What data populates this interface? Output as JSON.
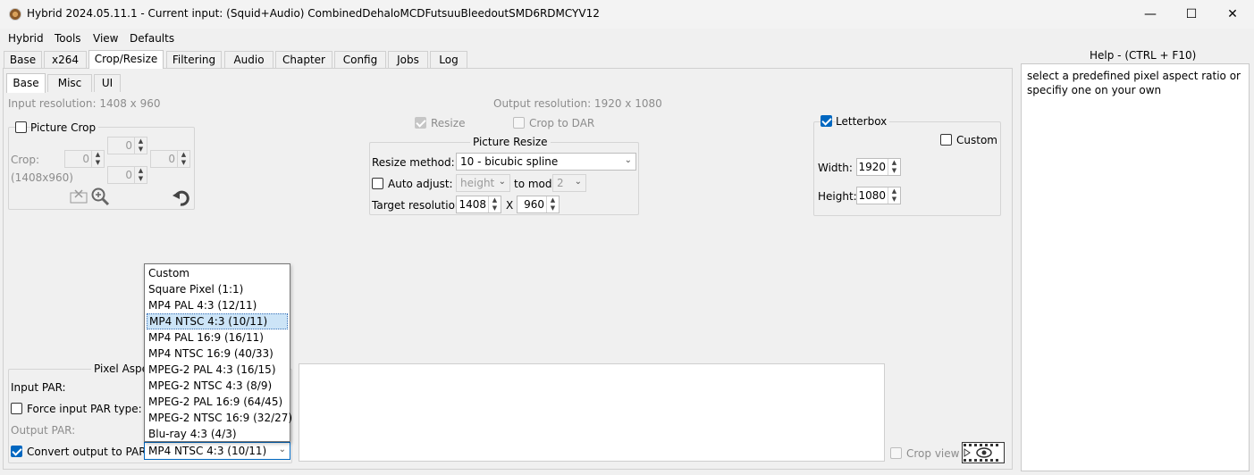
{
  "window": {
    "title": "Hybrid 2024.05.11.1 - Current input: (Squid+Audio) CombinedDehaloMCDFutsuuBleedoutSMD6RDMCYV12",
    "minimize": "—",
    "maximize": "☐",
    "close": "✕"
  },
  "menu": [
    "Hybrid",
    "Tools",
    "View",
    "Defaults"
  ],
  "main_tabs": [
    "Base",
    "x264",
    "Crop/Resize",
    "Filtering",
    "Audio",
    "Chapter",
    "Config",
    "Jobs",
    "Log"
  ],
  "sub_tabs": [
    "Base",
    "Misc",
    "UI"
  ],
  "input_resolution": "Input resolution: 1408 x 960",
  "output_resolution": "Output resolution: 1920 x 1080",
  "resize_label": "Resize",
  "crop_to_dar_label": "Crop to DAR",
  "picture_crop": {
    "title": "Picture Crop",
    "crop_label": "Crop:",
    "dims": "(1408x960)",
    "top": "0",
    "left": "0",
    "right": "0",
    "bottom": "0"
  },
  "picture_resize": {
    "title": "Picture Resize",
    "method_label": "Resize method:",
    "method_value": "10 - bicubic spline",
    "auto_adjust_label": "Auto adjust:",
    "auto_adjust_value": "height",
    "to_mod_label": "to mod",
    "to_mod_value": "2",
    "target_label": "Target resolution:",
    "target_w": "1408",
    "x": "X",
    "target_h": "960"
  },
  "letterbox": {
    "title": "Letterbox",
    "custom_label": "Custom",
    "width_label": "Width:",
    "width_value": "1920",
    "height_label": "Height:",
    "height_value": "1080"
  },
  "par": {
    "title": "Pixel Aspe",
    "input_par_label": "Input PAR:",
    "force_input_label": "Force input PAR type:",
    "output_par_label": "Output PAR:",
    "convert_label": "Convert output to PAR:",
    "convert_value": "MP4 NTSC 4:3 (10/11)"
  },
  "dropdown_items": [
    "Custom",
    "Square Pixel (1:1)",
    "MP4 PAL 4:3 (12/11)",
    "MP4 NTSC 4:3 (10/11)",
    "MP4 PAL 16:9  (16/11)",
    "MP4 NTSC 16:9 (40/33)",
    "MPEG-2 PAL 4:3 (16/15)",
    "MPEG-2 NTSC 4:3 (8/9)",
    "MPEG-2 PAL 16:9  (64/45)",
    "MPEG-2 NTSC 16:9 (32/27)",
    "Blu-ray 4:3 (4/3)"
  ],
  "crop_view_label": "Crop view",
  "help": {
    "title": "Help - (CTRL + F10)",
    "text": "select a predefined pixel aspect ratio or specifiy one on your own"
  }
}
